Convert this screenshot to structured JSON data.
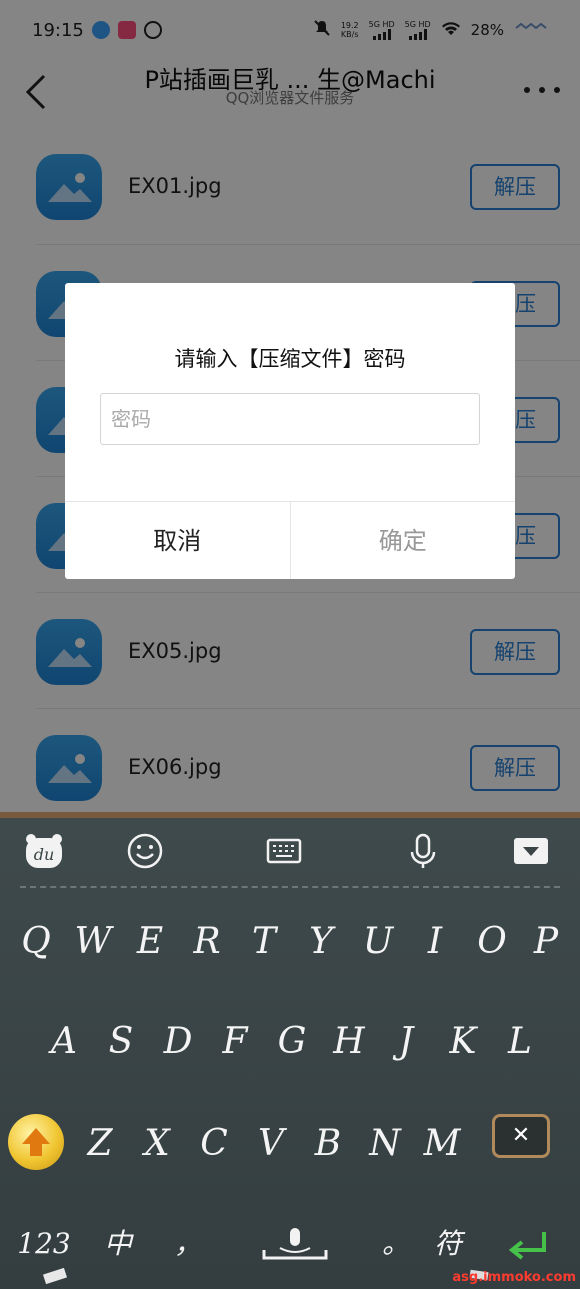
{
  "status_bar": {
    "time": "19:15",
    "net_speed_value": "19.2",
    "net_speed_unit": "KB/s",
    "signal_1": "5G HD",
    "signal_2": "5G HD",
    "battery": "28%"
  },
  "title_bar": {
    "title": "P站插画巨乳 ... 生@Machi",
    "subtitle": "QQ浏览器文件服务"
  },
  "files": [
    {
      "name": "EX01.jpg",
      "action": "解压"
    },
    {
      "name": "",
      "action": "解压"
    },
    {
      "name": "",
      "action": "解压"
    },
    {
      "name": "",
      "action": "解压"
    },
    {
      "name": "EX05.jpg",
      "action": "解压"
    },
    {
      "name": "EX06.jpg",
      "action": "解压"
    }
  ],
  "dialog": {
    "title": "请输入【压缩文件】密码",
    "placeholder": "密码",
    "value": "",
    "cancel": "取消",
    "confirm": "确定"
  },
  "keyboard": {
    "row1": [
      "Q",
      "W",
      "E",
      "R",
      "T",
      "Y",
      "U",
      "I",
      "O",
      "P"
    ],
    "row2": [
      "A",
      "S",
      "D",
      "F",
      "G",
      "H",
      "J",
      "K",
      "L"
    ],
    "row3": [
      "Z",
      "X",
      "C",
      "V",
      "B",
      "N",
      "M"
    ],
    "numbers_key": "123",
    "lang_key": "中",
    "comma_key": "，",
    "period_key": "。",
    "symbols_key": "符",
    "logo": "du"
  },
  "watermark": "asg.immoko.com"
}
